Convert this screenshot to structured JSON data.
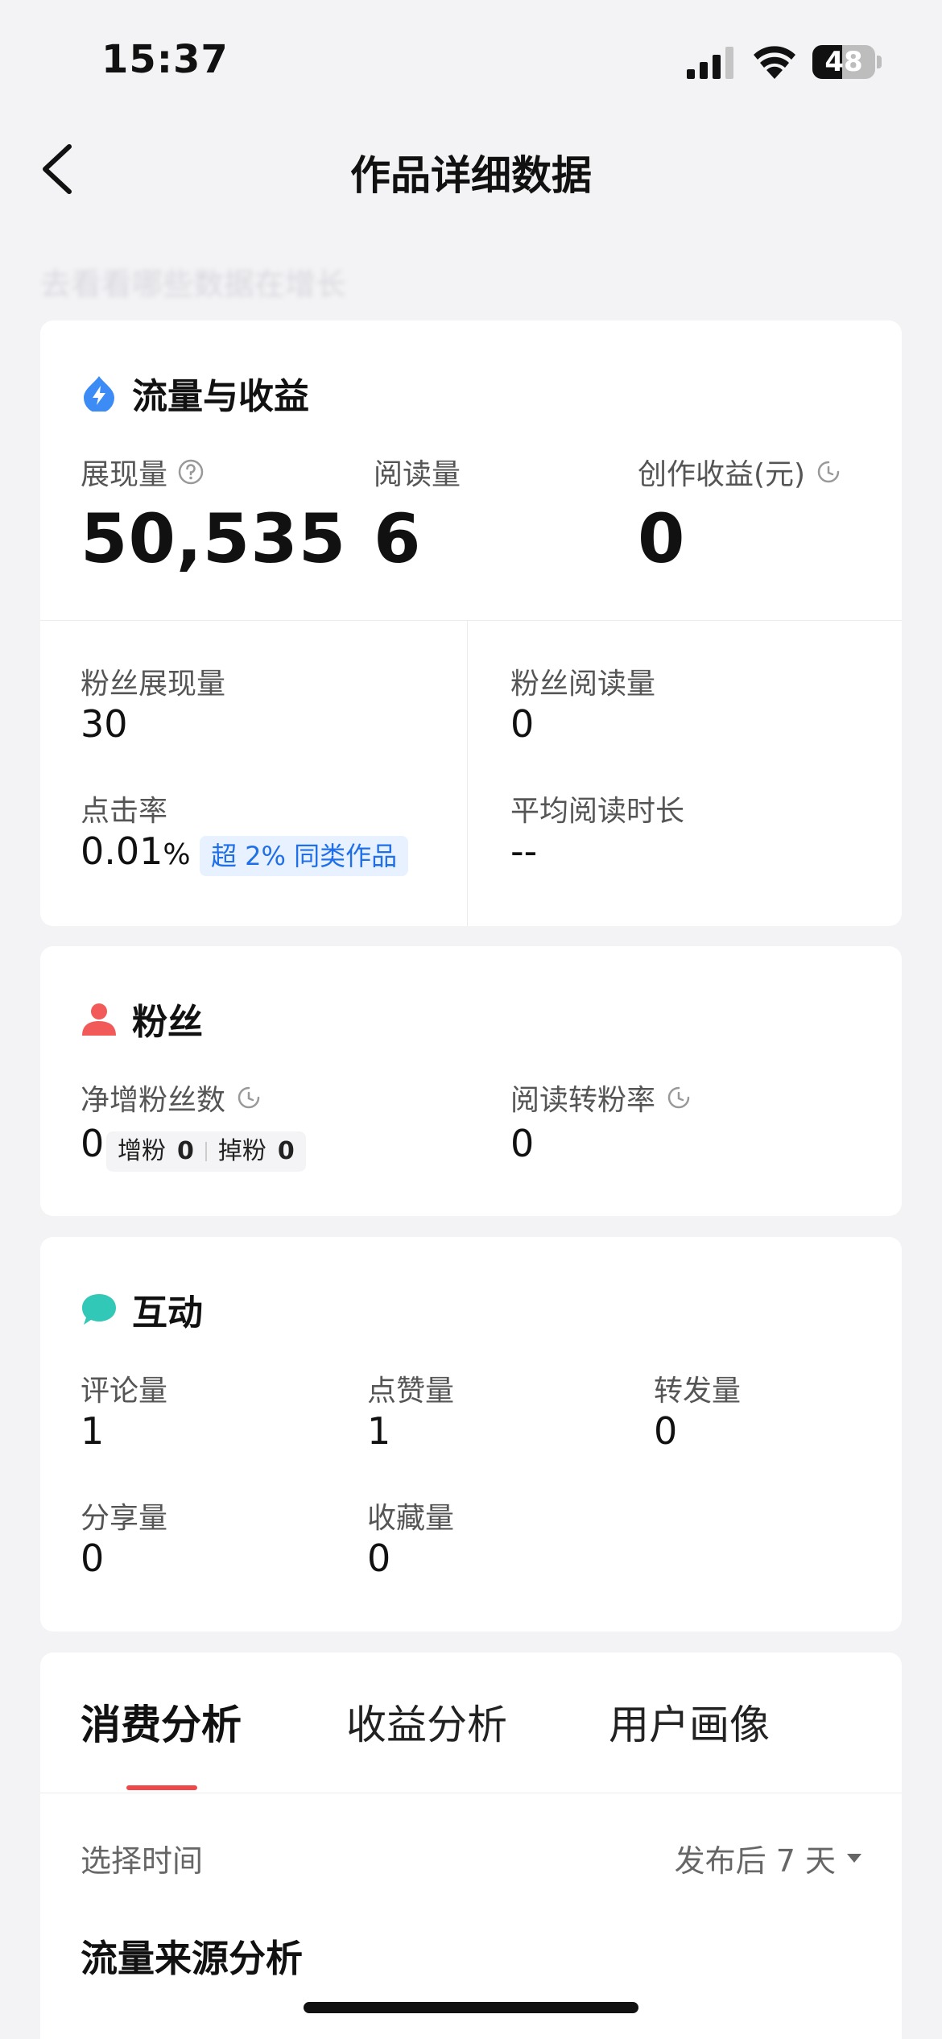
{
  "status_bar": {
    "time": "15:37",
    "battery": "48",
    "battery_level": 0.48
  },
  "nav": {
    "title": "作品详细数据"
  },
  "faded_subtitle": "去看看哪些数据在增长",
  "traffic": {
    "title": "流量与收益",
    "impressions_label": "展现量",
    "impressions_value": "50,535",
    "reads_label": "阅读量",
    "reads_value": "6",
    "earnings_label": "创作收益(元)",
    "earnings_value": "0",
    "fan_impressions_label": "粉丝展现量",
    "fan_impressions_value": "30",
    "fan_reads_label": "粉丝阅读量",
    "fan_reads_value": "0",
    "ctr_label": "点击率",
    "ctr_value": "0.01",
    "ctr_unit": "%",
    "ctr_badge": "超 2% 同类作品",
    "avg_read_time_label": "平均阅读时长",
    "avg_read_time_value": "--"
  },
  "fans": {
    "title": "粉丝",
    "net_gain_label": "净增粉丝数",
    "net_gain_value": "0",
    "gain_label": "增粉",
    "gain_value": "0",
    "loss_label": "掉粉",
    "loss_value": "0",
    "conversion_label": "阅读转粉率",
    "conversion_value": "0"
  },
  "interaction": {
    "title": "互动",
    "comments_label": "评论量",
    "comments_value": "1",
    "likes_label": "点赞量",
    "likes_value": "1",
    "reposts_label": "转发量",
    "reposts_value": "0",
    "shares_label": "分享量",
    "shares_value": "0",
    "favorites_label": "收藏量",
    "favorites_value": "0"
  },
  "analysis": {
    "tabs": [
      "消费分析",
      "收益分析",
      "用户画像"
    ],
    "active_tab": 0,
    "time_label": "选择时间",
    "time_value": "发布后 7 天",
    "section_heading": "流量来源分析"
  }
}
